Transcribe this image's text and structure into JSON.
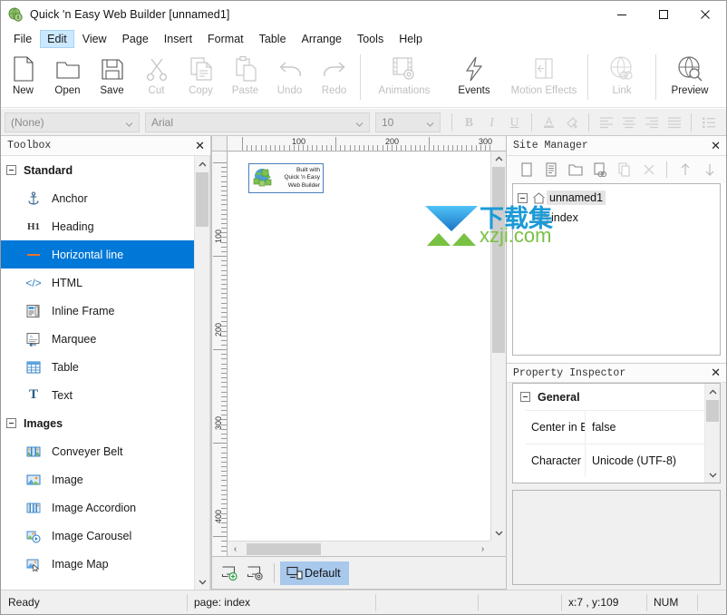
{
  "window": {
    "title": "Quick 'n Easy Web Builder [unnamed1]",
    "app_icon": "app-globe-icon",
    "minimize": "—",
    "maximize": "□",
    "close": "✕"
  },
  "menubar": {
    "items": [
      {
        "label": "File",
        "active": false
      },
      {
        "label": "Edit",
        "active": true
      },
      {
        "label": "View",
        "active": false
      },
      {
        "label": "Page",
        "active": false
      },
      {
        "label": "Insert",
        "active": false
      },
      {
        "label": "Format",
        "active": false
      },
      {
        "label": "Table",
        "active": false
      },
      {
        "label": "Arrange",
        "active": false
      },
      {
        "label": "Tools",
        "active": false
      },
      {
        "label": "Help",
        "active": false
      }
    ]
  },
  "toolbar": {
    "buttons": [
      {
        "label": "New",
        "icon": "new-page-icon",
        "enabled": true
      },
      {
        "label": "Open",
        "icon": "open-folder-icon",
        "enabled": true
      },
      {
        "label": "Save",
        "icon": "floppy-disk-icon",
        "enabled": true
      },
      {
        "label": "Cut",
        "icon": "scissors-icon",
        "enabled": false
      },
      {
        "label": "Copy",
        "icon": "copy-icon",
        "enabled": false
      },
      {
        "label": "Paste",
        "icon": "clipboard-icon",
        "enabled": false
      },
      {
        "label": "Undo",
        "icon": "undo-arrow-icon",
        "enabled": false
      },
      {
        "label": "Redo",
        "icon": "redo-arrow-icon",
        "enabled": false
      },
      {
        "label": "Animations",
        "icon": "film-gear-icon",
        "enabled": false
      },
      {
        "label": "Events",
        "icon": "lightning-bolt-icon",
        "enabled": true
      },
      {
        "label": "Motion Effects",
        "icon": "motion-panel-icon",
        "enabled": false
      },
      {
        "label": "Link",
        "icon": "globe-link-icon",
        "enabled": false
      },
      {
        "label": "Preview",
        "icon": "globe-search-icon",
        "enabled": true
      }
    ]
  },
  "formatbar": {
    "style_select": "(None)",
    "font_select": "Arial",
    "size_select": "10",
    "bold": "B",
    "italic": "I",
    "underline": "U",
    "font_color": "A",
    "highlight": "🖌",
    "align_left": "align-left",
    "align_center": "align-center",
    "align_right": "align-right",
    "align_justify": "align-justify",
    "bullet_list": "bullet-list"
  },
  "toolbox": {
    "title": "Toolbox",
    "close": "✕",
    "entries": [
      {
        "type": "group",
        "label": "Standard"
      },
      {
        "type": "item",
        "label": "Anchor",
        "icon": "anchor-icon",
        "selected": false
      },
      {
        "type": "item",
        "label": "Heading",
        "icon": "heading-h1-icon",
        "selected": false
      },
      {
        "type": "item",
        "label": "Horizontal line",
        "icon": "horizontal-line-icon",
        "selected": true
      },
      {
        "type": "item",
        "label": "HTML",
        "icon": "html-code-icon",
        "selected": false
      },
      {
        "type": "item",
        "label": "Inline Frame",
        "icon": "inline-frame-icon",
        "selected": false
      },
      {
        "type": "item",
        "label": "Marquee",
        "icon": "marquee-icon",
        "selected": false
      },
      {
        "type": "item",
        "label": "Table",
        "icon": "table-grid-icon",
        "selected": false
      },
      {
        "type": "item",
        "label": "Text",
        "icon": "text-t-icon",
        "selected": false
      },
      {
        "type": "group",
        "label": "Images"
      },
      {
        "type": "item",
        "label": "Conveyer Belt",
        "icon": "conveyer-belt-icon",
        "selected": false
      },
      {
        "type": "item",
        "label": "Image",
        "icon": "image-icon",
        "selected": false
      },
      {
        "type": "item",
        "label": "Image Accordion",
        "icon": "image-accordion-icon",
        "selected": false
      },
      {
        "type": "item",
        "label": "Image Carousel",
        "icon": "image-carousel-icon",
        "selected": false
      },
      {
        "type": "item",
        "label": "Image Map",
        "icon": "image-map-icon",
        "selected": false
      }
    ]
  },
  "canvas": {
    "ruler_h_labels": [
      "100",
      "200",
      "300"
    ],
    "ruler_v_labels": [
      "100",
      "200",
      "300",
      "400"
    ],
    "badge": {
      "line1": "Built with",
      "line2": "Quick 'n Easy",
      "line3": "Web Builder",
      "icon": "cubes-globe-icon"
    },
    "scroll_left": "‹",
    "scroll_right": "›",
    "scroll_up": "∧",
    "scroll_down": "∨"
  },
  "bottombar": {
    "add_breakpoint_icon": "add-layout-icon",
    "settings_breakpoint_icon": "layout-settings-icon",
    "tab_icon": "desktop-device-icon",
    "tab_label": "Default"
  },
  "site_manager": {
    "title": "Site Manager",
    "close": "✕",
    "toolbar_icons": [
      {
        "name": "new-page-icon",
        "enabled": true
      },
      {
        "name": "page-list-icon",
        "enabled": true
      },
      {
        "name": "new-folder-icon",
        "enabled": true
      },
      {
        "name": "link-page-icon",
        "enabled": true
      },
      {
        "name": "duplicate-icon",
        "enabled": false
      },
      {
        "name": "delete-x-icon",
        "enabled": false
      },
      {
        "name": "move-up-icon",
        "enabled": false
      },
      {
        "name": "move-down-icon",
        "enabled": false
      }
    ],
    "tree": [
      {
        "label": "unnamed1",
        "icon": "site-home-icon",
        "selected": true,
        "depth": 0
      },
      {
        "label": "index",
        "icon": "page-icon",
        "selected": false,
        "depth": 1
      }
    ]
  },
  "property_inspector": {
    "title": "Property Inspector",
    "close": "✕",
    "group": "General",
    "rows": [
      {
        "key": "Center in B",
        "value": "false"
      },
      {
        "key": "Character ",
        "value": "Unicode (UTF-8)"
      }
    ],
    "scroll_up": "∧",
    "scroll_down": "∨"
  },
  "statusbar": {
    "ready": "Ready",
    "page": "page: index",
    "blank1": "",
    "blank2": "",
    "coords": "x:7 , y:109",
    "num_lock": "NUM"
  },
  "watermark": {
    "text_cn": "下载集",
    "text_en": "xzji.com"
  },
  "colors": {
    "accent": "#0078d7",
    "menu_active": "#cce8ff",
    "tab_active": "#a8c8ec",
    "panel_bg": "#f0f0f0",
    "wm_blue": "#1b9ad6",
    "wm_green": "#7ac143"
  }
}
